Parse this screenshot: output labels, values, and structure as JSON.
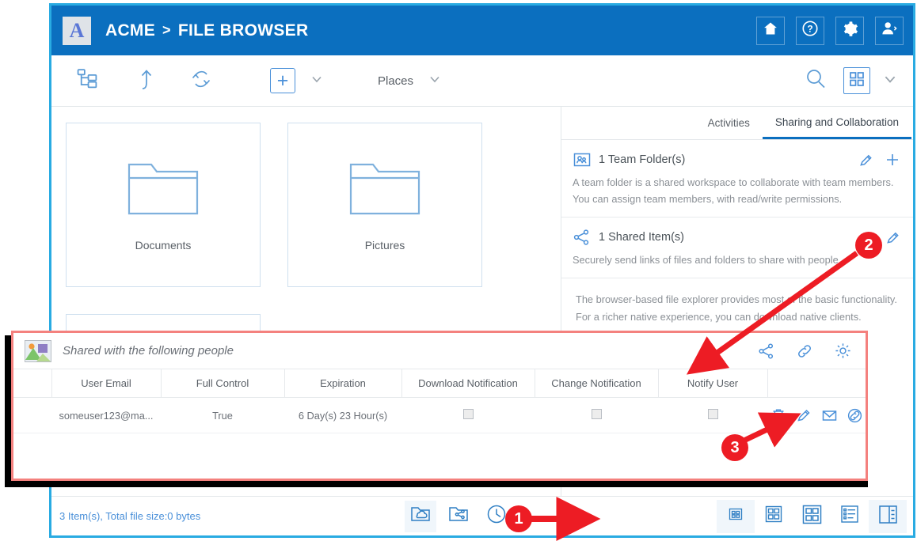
{
  "header": {
    "logo_letter": "A",
    "brand": "ACME",
    "separator": ">",
    "section": "FILE BROWSER",
    "actions": [
      {
        "name": "home-icon",
        "label": "Home"
      },
      {
        "name": "help-icon",
        "label": "Help"
      },
      {
        "name": "settings-gear-icon",
        "label": "Settings"
      },
      {
        "name": "user-account-icon",
        "label": "Account"
      }
    ]
  },
  "toolbar": {
    "tree_view_label": "Tree View",
    "up_label": "Up one level",
    "refresh_label": "Refresh",
    "new_label": "+",
    "places_label": "Places",
    "search_label": "Search",
    "view_label": "View"
  },
  "files": {
    "tiles": [
      {
        "name": "Documents"
      },
      {
        "name": "Pictures"
      }
    ]
  },
  "side_panel": {
    "tabs": [
      {
        "label": "Activities",
        "active": false
      },
      {
        "label": "Sharing and Collaboration",
        "active": true
      }
    ],
    "sections": [
      {
        "title": "1 Team Folder(s)",
        "description": "A team folder is a shared workspace to collaborate with team members. You can assign team members, with read/write permissions.",
        "icon": "team-folder-icon",
        "actions": [
          "edit-pencil-icon",
          "add-plus-icon"
        ]
      },
      {
        "title": "1 Shared Item(s)",
        "description": "Securely send links of files and folders to share with people.",
        "icon": "share-nodes-icon",
        "actions": [
          "edit-pencil-icon"
        ]
      }
    ],
    "note": "The browser-based file explorer provides most of the basic functionality. For a richer native experience, you can download native clients."
  },
  "modal": {
    "title": "Shared with the following people",
    "head_actions": [
      {
        "name": "share-nodes-icon",
        "label": "Share"
      },
      {
        "name": "link-icon",
        "label": "Copy link"
      },
      {
        "name": "settings-gear-icon",
        "label": "Settings"
      }
    ],
    "columns": [
      "User Email",
      "Full Control",
      "Expiration",
      "Download Notification",
      "Change Notification",
      "Notify User",
      ""
    ],
    "rows": [
      {
        "user_email": "someuser123@ma...",
        "full_control": "True",
        "expiration": "6 Day(s) 23 Hour(s)",
        "download_notification": false,
        "change_notification": false,
        "notify_user": false,
        "actions": [
          "delete-trash-icon",
          "edit-pencil-icon",
          "email-envelope-icon",
          "link-icon"
        ]
      }
    ]
  },
  "status_bar": {
    "summary": "3 Item(s), Total file size:0 bytes",
    "center_buttons": [
      {
        "name": "cloud-folder-icon",
        "label": "Cloud Folder",
        "active": true
      },
      {
        "name": "shared-folder-icon",
        "label": "Shared Folder",
        "active": false
      },
      {
        "name": "history-clock-icon",
        "label": "History",
        "active": false
      }
    ],
    "view_buttons": [
      {
        "name": "view-small-grid-icon",
        "label": "Small icons",
        "active": true
      },
      {
        "name": "view-medium-grid-icon",
        "label": "Medium icons",
        "active": false
      },
      {
        "name": "view-large-grid-icon",
        "label": "Large icons",
        "active": false
      },
      {
        "name": "view-details-list-icon",
        "label": "Details",
        "active": false
      },
      {
        "name": "view-split-pane-icon",
        "label": "Preview pane",
        "active": true
      }
    ]
  },
  "annotations": {
    "colors": {
      "badge": "#ED1C24",
      "modal_border": "#F4817E",
      "accent": "#0B6FBF",
      "window_border": "#29ABE2"
    },
    "markers": [
      {
        "number": "1",
        "target": "cloud-folder-icon"
      },
      {
        "number": "2",
        "target": "shared-items-edit-pencil"
      },
      {
        "number": "3",
        "target": "row-delete-trash-icon"
      }
    ]
  }
}
